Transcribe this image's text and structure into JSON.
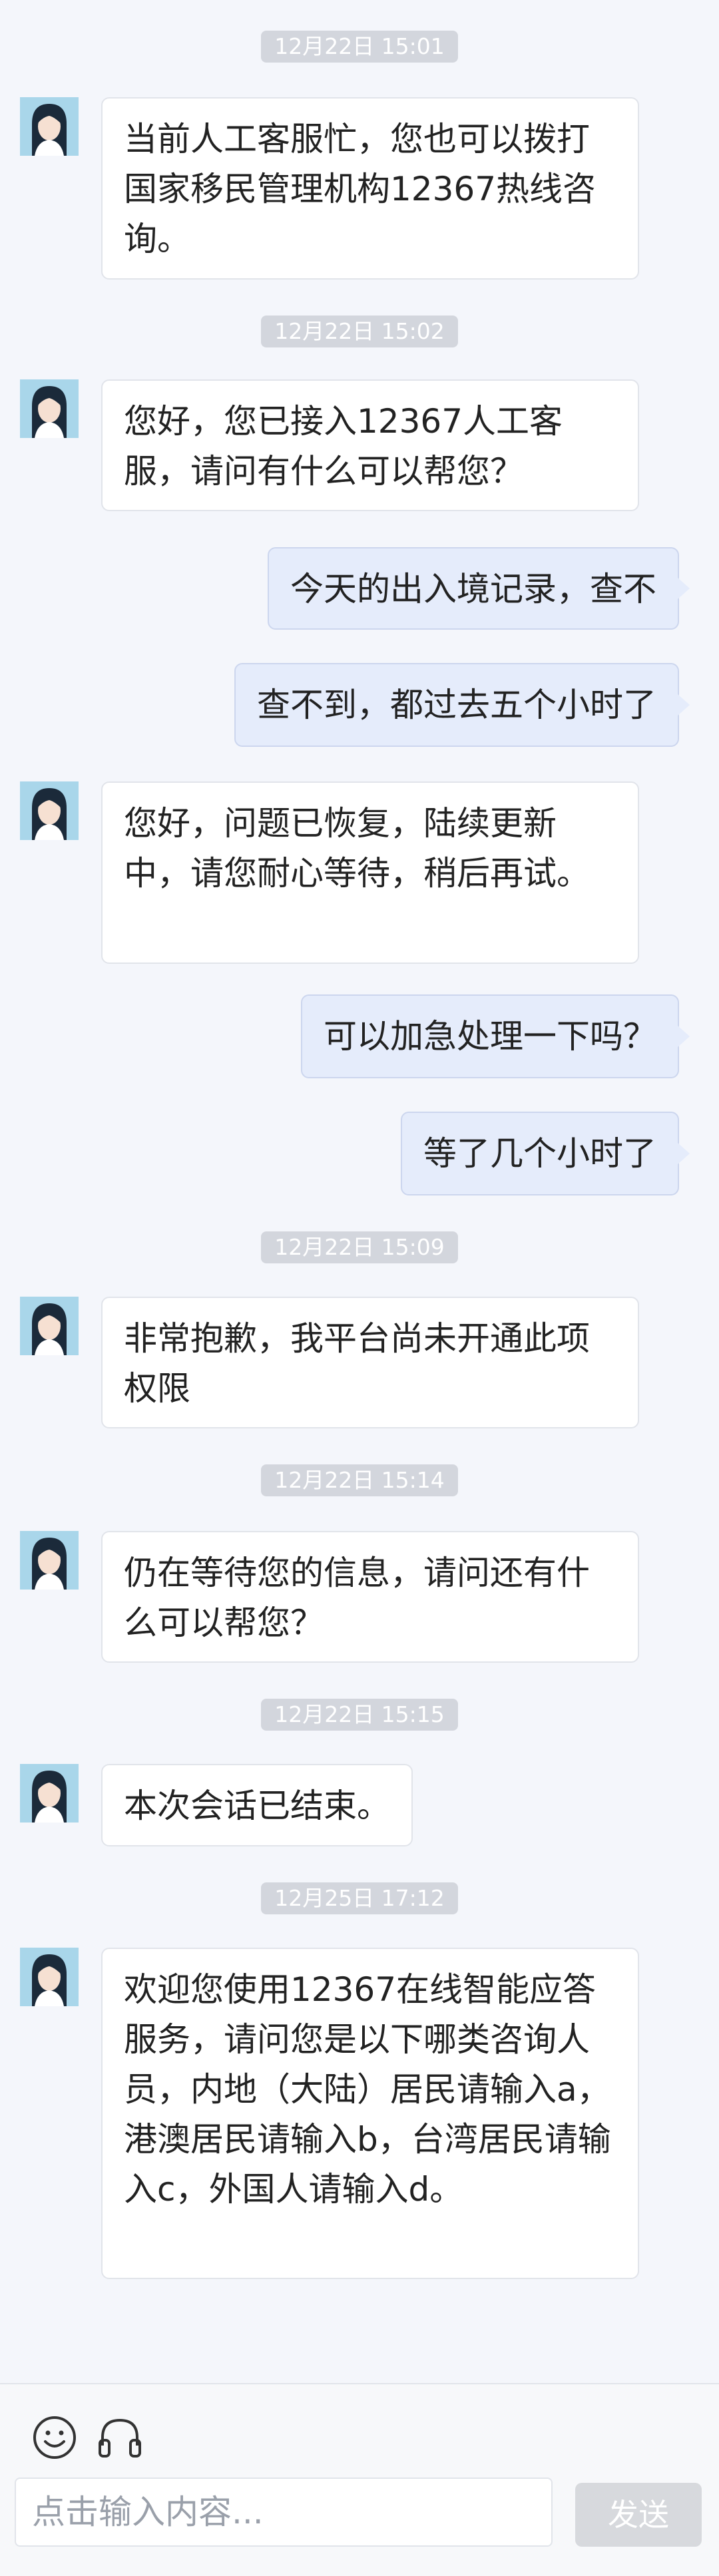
{
  "messages": [
    {
      "type": "time",
      "text": "12月22日 15:01"
    },
    {
      "type": "agent",
      "text": "当前人工客服忙，您也可以拨打国家移民管理机构12367热线咨询。"
    },
    {
      "type": "time",
      "text": "12月22日 15:02"
    },
    {
      "type": "agent",
      "text": "您好，您已接入12367人工客服，请问有什么可以帮您？"
    },
    {
      "type": "user",
      "text": "今天的出入境记录，查不"
    },
    {
      "type": "user",
      "text": "查不到，都过去五个小时了"
    },
    {
      "type": "agent",
      "text": "您好，问题已恢复，陆续更新中，请您耐心等待，稍后再试。"
    },
    {
      "type": "user",
      "text": "可以加急处理一下吗？"
    },
    {
      "type": "user",
      "text": "等了几个小时了"
    },
    {
      "type": "time",
      "text": "12月22日 15:09"
    },
    {
      "type": "agent",
      "text": "非常抱歉，我平台尚未开通此项权限"
    },
    {
      "type": "time",
      "text": "12月22日 15:14"
    },
    {
      "type": "agent",
      "text": "仍在等待您的信息，请问还有什么可以帮您？"
    },
    {
      "type": "time",
      "text": "12月22日 15:15"
    },
    {
      "type": "agent",
      "text": "本次会话已结束。"
    },
    {
      "type": "time",
      "text": "12月25日 17:12"
    },
    {
      "type": "agent",
      "text": "欢迎您使用12367在线智能应答服务，请问您是以下哪类咨询人员，内地（大陆）居民请输入a，港澳居民请输入b，台湾居民请输入c，外国人请输入d。"
    }
  ],
  "input": {
    "placeholder": "点击输入内容..."
  },
  "send_label": "发送",
  "icons": {
    "emoji": "smiley-icon",
    "voice": "headset-icon"
  },
  "colors": {
    "background": "#f4f6fb",
    "user_bubble": "#e5ecfb",
    "agent_bubble": "#ffffff",
    "avatar_bg": "#a9d6ea"
  }
}
